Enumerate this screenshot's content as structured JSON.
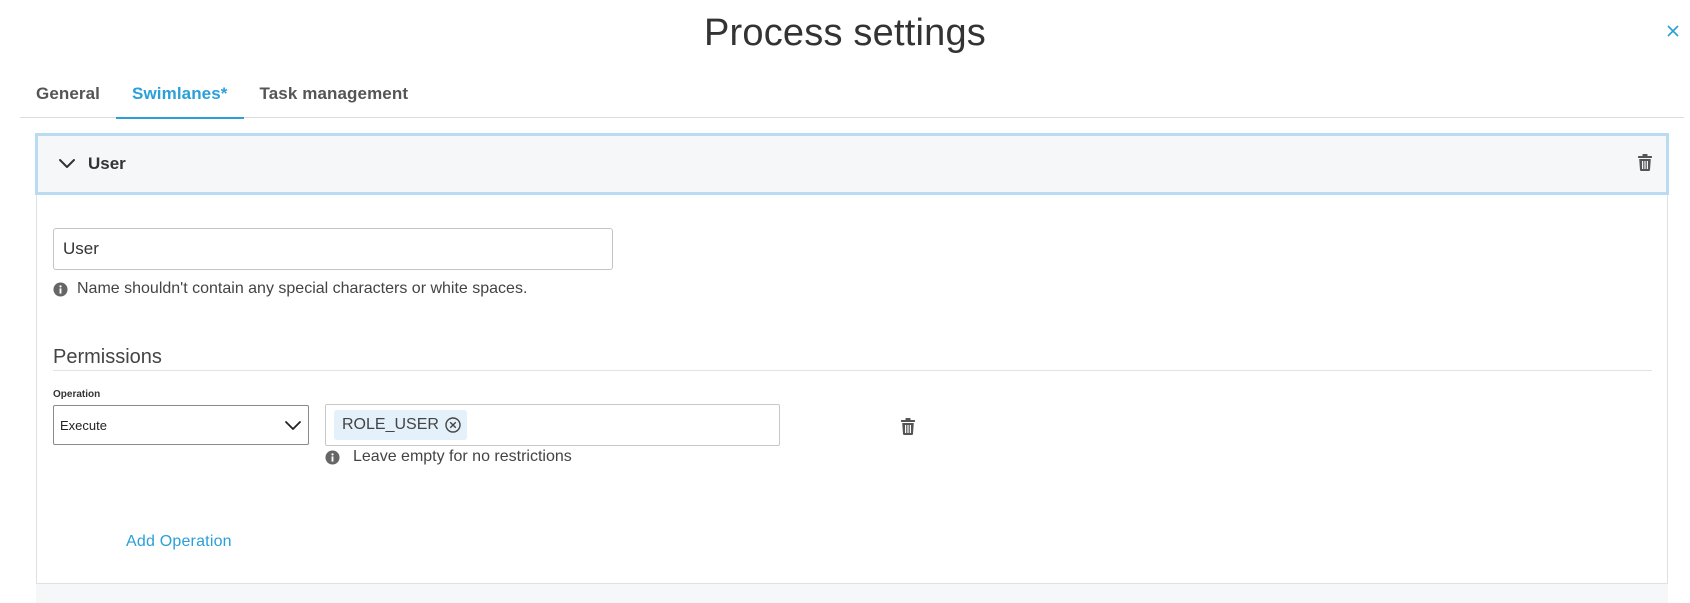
{
  "dialog": {
    "title": "Process settings",
    "close_icon": "close-icon"
  },
  "tabs": [
    {
      "label": "General",
      "active": false
    },
    {
      "label": "Swimlanes*",
      "active": true
    },
    {
      "label": "Task management",
      "active": false
    }
  ],
  "swimlane": {
    "header_label": "User",
    "expanded": true,
    "name_value": "User",
    "name_hint": "Name shouldn't contain any special characters or white spaces.",
    "permissions": {
      "section_title": "Permissions",
      "operation_label": "Operation",
      "operation_value": "Execute",
      "roles": [
        "ROLE_USER"
      ],
      "roles_hint": "Leave empty for no restrictions"
    },
    "add_operation_label": "Add Operation"
  },
  "colors": {
    "accent": "#2a9fd8",
    "header_border": "#b9dcf2",
    "chip_bg": "#e4f1fa"
  }
}
